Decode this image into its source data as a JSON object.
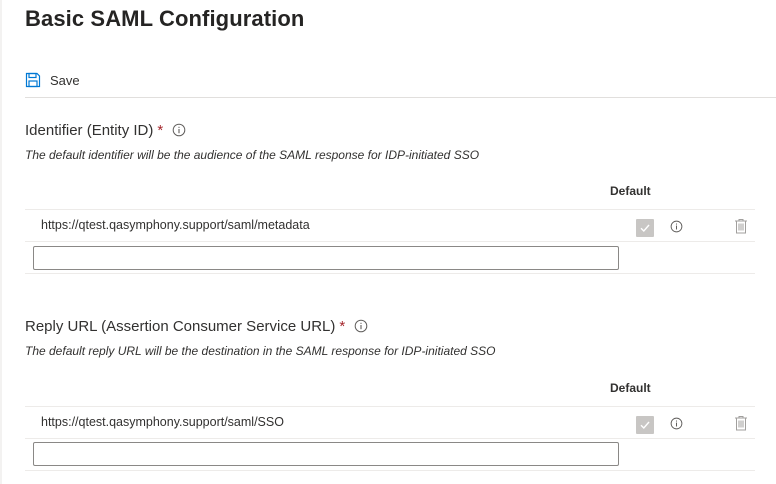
{
  "page": {
    "title": "Basic SAML Configuration"
  },
  "toolbar": {
    "save_label": "Save",
    "save_icon": "save-icon"
  },
  "identifier": {
    "title": "Identifier (Entity ID)",
    "required_mark": "*",
    "description": "The default identifier will be the audience of the SAML response for IDP-initiated SSO",
    "column_header": "Default",
    "rows": [
      {
        "value": "https://qtest.qasymphony.support/saml/metadata",
        "default": true
      }
    ],
    "new_value": "",
    "new_placeholder": ""
  },
  "reply_url": {
    "title": "Reply URL (Assertion Consumer Service URL)",
    "required_mark": "*",
    "description": "The default reply URL will be the destination in the SAML response for IDP-initiated SSO",
    "column_header": "Default",
    "rows": [
      {
        "value": "https://qtest.qasymphony.support/saml/SSO",
        "default": true
      }
    ],
    "new_value": "",
    "new_placeholder": ""
  },
  "colors": {
    "accent": "#0078d4",
    "required": "#a4262c",
    "disabled_checkbox": "#c8c6c4"
  }
}
